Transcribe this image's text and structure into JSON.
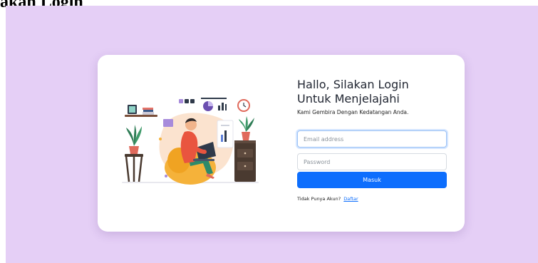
{
  "page": {
    "heading": "akan Login"
  },
  "illustration": {
    "icon": "person-working-on-laptop-illustration"
  },
  "login": {
    "title_line1": "Hallo, Silakan Login",
    "title_line2": "Untuk Menjelajahi",
    "subtitle": "Kami Gembira Dengan Kedatangan Anda.",
    "email_placeholder": "Email address",
    "password_placeholder": "Password",
    "submit_label": "Masuk",
    "signup_prompt": "Tidak Punya Akun?",
    "signup_link": "Daftar"
  },
  "colors": {
    "background": "#e5cff6",
    "card": "#ffffff",
    "primary": "#0d6efd",
    "title_text": "#1f2430"
  }
}
